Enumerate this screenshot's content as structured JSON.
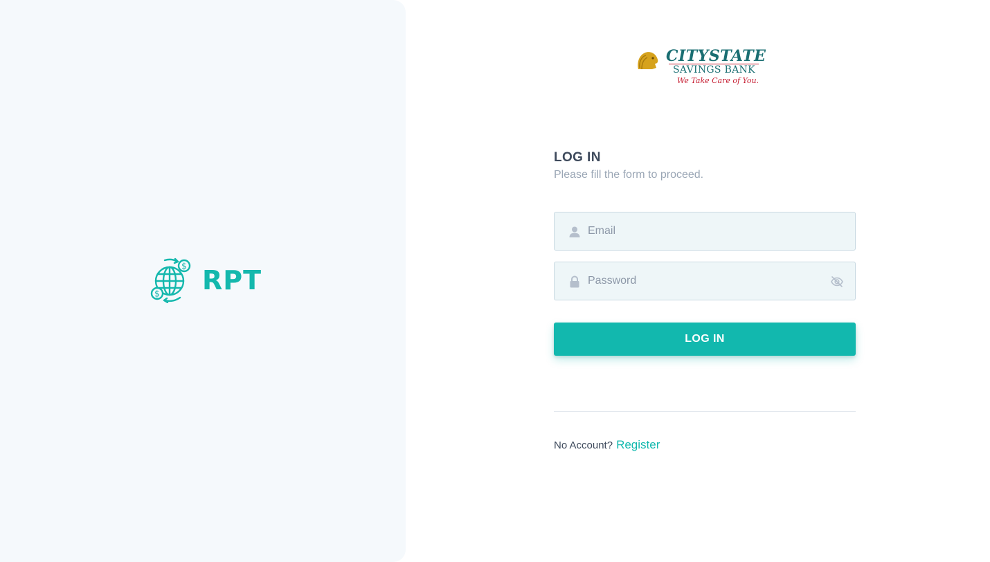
{
  "brand": {
    "app_name": "RPT",
    "accent_color": "#12b8ae"
  },
  "bank": {
    "name": "CITYSTATE",
    "sub": "SAVINGS BANK",
    "tagline": "We Take Care of You."
  },
  "login_form": {
    "title": "LOG IN",
    "subtitle": "Please fill the form to proceed.",
    "email": {
      "value": "",
      "placeholder": "Email",
      "icon": "user-icon"
    },
    "password": {
      "value": "",
      "placeholder": "Password",
      "icon": "lock-icon",
      "toggle_icon": "eye-off-icon"
    },
    "submit_label": "LOG IN"
  },
  "footer": {
    "prompt": "No Account?",
    "register_label": "Register"
  }
}
